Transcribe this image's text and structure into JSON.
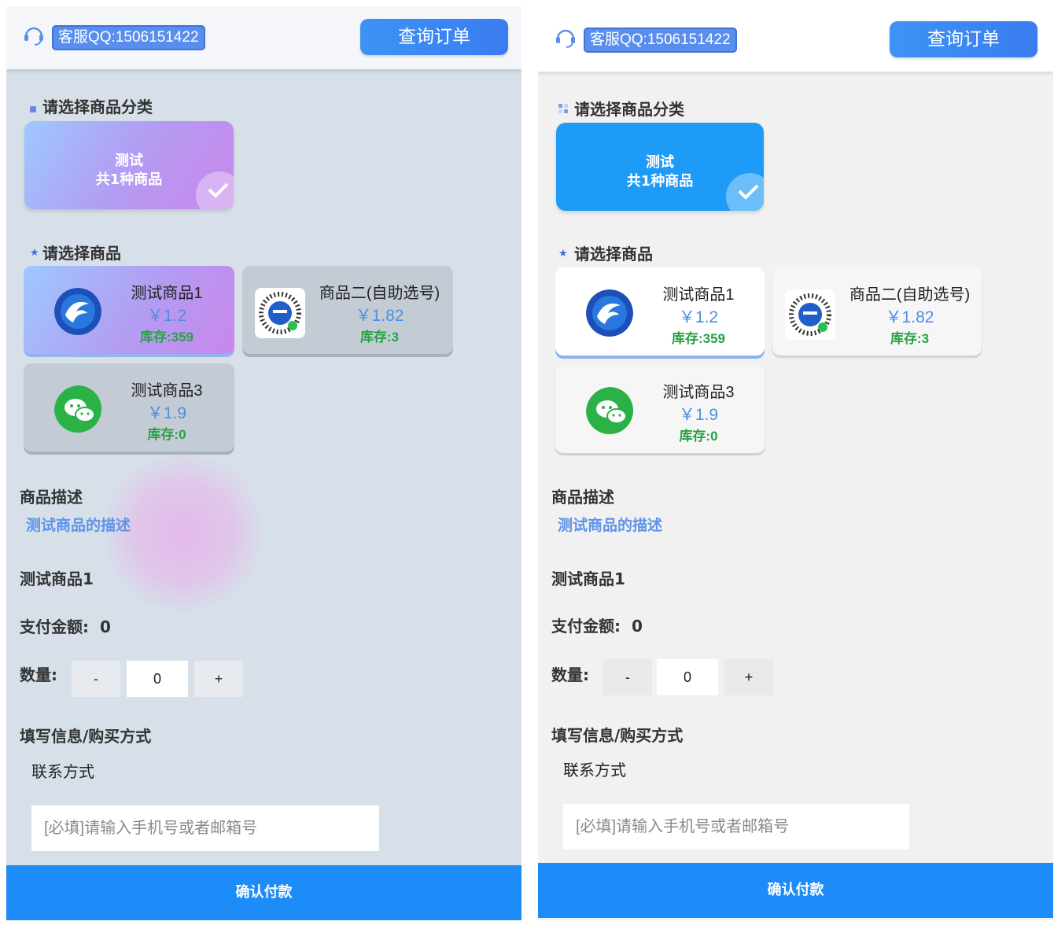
{
  "header": {
    "qq_text": "客服QQ:1506151422",
    "query_button": "查询订单"
  },
  "categories_title": "请选择商品分类",
  "category": {
    "name": "测试",
    "count_text": "共1种商品"
  },
  "products_title": "请选择商品",
  "products": [
    {
      "name": "测试商品1",
      "price": "￥1.2",
      "stock": "库存:359",
      "icon": "dragon-logo-icon"
    },
    {
      "name": "商品二(自助选号)",
      "price": "￥1.82",
      "stock": "库存:3",
      "icon": "qr-code-icon"
    },
    {
      "name": "测试商品3",
      "price": "￥1.9",
      "stock": "库存:0",
      "icon": "wechat-icon"
    }
  ],
  "description": {
    "label": "商品描述",
    "text": "测试商品的描述"
  },
  "selected_product": "测试商品1",
  "payment": {
    "label": "支付金额:",
    "value": "0"
  },
  "quantity": {
    "label": "数量:",
    "minus": "-",
    "value": "0",
    "plus": "+"
  },
  "info": {
    "title": "填写信息/购买方式",
    "contact_label": "联系方式",
    "contact_placeholder": "[必填]请输入手机号或者邮箱号"
  },
  "confirm_button": "确认付款",
  "colors": {
    "accent_blue": "#1e8cf8",
    "price_blue": "#4a90e8",
    "stock_green": "#27a243",
    "category_blue": "#1e9bf7"
  }
}
